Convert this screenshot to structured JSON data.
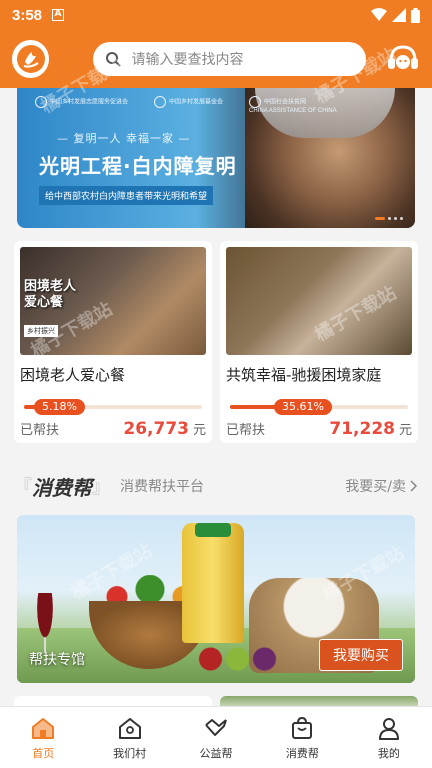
{
  "status_bar": {
    "time": "3:58",
    "badge": "A"
  },
  "search": {
    "placeholder": "请输入要查找内容"
  },
  "banner": {
    "orgs": [
      "中国乡村发展志愿服务促进会",
      "中国乡村发展基金会",
      "中国社会扶贫网"
    ],
    "org_sub": "CHINA ASSISTANCE OF CHINA",
    "slogan_sub": "— 复明一人 幸福一家 —",
    "slogan_main": "光明工程·白内障复明",
    "slogan_note": "给中西部农村白内障患者带来光明和希望"
  },
  "projects": [
    {
      "title": "困境老人爱心餐",
      "thumb_title": "困境老人\n爱心餐",
      "thumb_tag": "乡村振兴",
      "progress_label": "5.18%",
      "progress": 0.0518,
      "helped_label": "已帮扶",
      "amount": "26,773",
      "unit": "元"
    },
    {
      "title": "共筑幸福-驰援困境家庭",
      "progress_label": "35.61%",
      "progress": 0.3561,
      "helped_label": "已帮扶",
      "amount": "71,228",
      "unit": "元"
    }
  ],
  "consumption": {
    "title": "消费帮",
    "bracket_left": "『",
    "bracket_right": "』",
    "subtitle": "消费帮扶平台",
    "more": "我要买/卖",
    "banner_label": "帮扶专馆",
    "buy_button": "我要购买"
  },
  "tabs": [
    {
      "label": "首页",
      "icon": "home-icon",
      "active": true
    },
    {
      "label": "我们村",
      "icon": "village-icon",
      "active": false
    },
    {
      "label": "公益帮",
      "icon": "handshake-icon",
      "active": false
    },
    {
      "label": "消费帮",
      "icon": "shopping-bag-icon",
      "active": false
    },
    {
      "label": "我的",
      "icon": "person-icon",
      "active": false
    }
  ],
  "watermark": "橘子下载站",
  "colors": {
    "brand": "#f07d24",
    "accent_red": "#e84a3c",
    "progress": "#e8501f"
  }
}
